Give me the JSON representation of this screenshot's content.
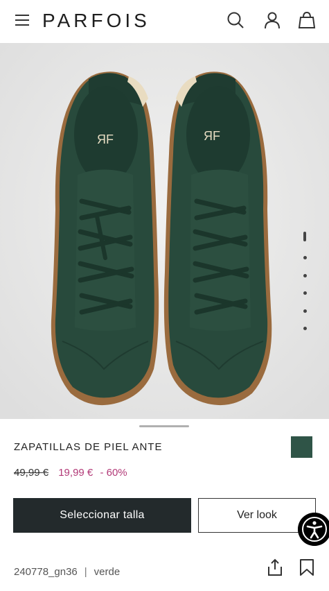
{
  "header": {
    "logo": "PARFOIS",
    "icons": [
      "menu-icon",
      "search-icon",
      "user-icon",
      "bag-icon"
    ]
  },
  "gallery": {
    "image": "green-suede-sneakers",
    "insole_mark": "ЯF",
    "current_slide": 1,
    "total_slides": 6
  },
  "product": {
    "title": "ZAPATILLAS DE PIEL ANTE",
    "old_price": "49,99 €",
    "new_price": "19,99 €",
    "discount": "- 60%",
    "swatch_color": "#2f5447",
    "reference": "240778_gn36",
    "separator": "|",
    "color_name": "verde"
  },
  "actions": {
    "select_size": "Seleccionar talla",
    "see_look": "Ver look"
  },
  "colors": {
    "primary_button": "#232a2c",
    "price_accent": "#b23a78"
  }
}
